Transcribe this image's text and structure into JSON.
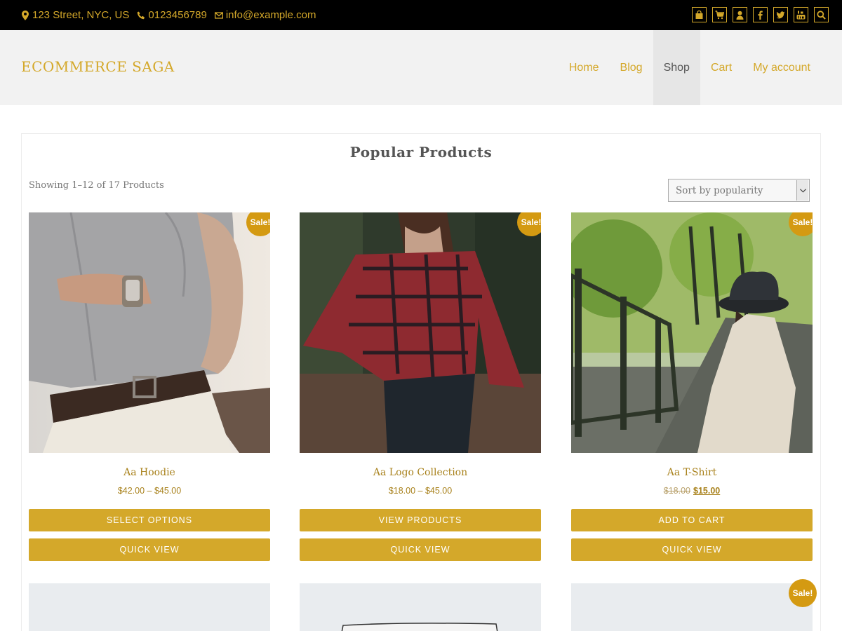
{
  "topbar": {
    "address": "123 Street, NYC, US",
    "phone": "0123456789",
    "email": "info@example.com",
    "social_icons": [
      "bag-icon",
      "cart-icon",
      "user-icon",
      "facebook-icon",
      "twitter-icon",
      "youtube-icon",
      "search-icon"
    ]
  },
  "header": {
    "logo": "ECOMMERCE SAGA",
    "nav": [
      {
        "label": "Home",
        "active": false
      },
      {
        "label": "Blog",
        "active": false
      },
      {
        "label": "Shop",
        "active": true
      },
      {
        "label": "Cart",
        "active": false
      },
      {
        "label": "My account",
        "active": false
      }
    ]
  },
  "shop": {
    "title": "Popular Products",
    "result_count": "Showing 1–12 of 17 Products",
    "sort_selected": "Sort by popularity",
    "sale_label": "Sale!",
    "quick_view_label": "QUICK VIEW",
    "products": [
      {
        "name": "Aa Hoodie",
        "price": "$42.00 – $45.00",
        "old_price": "",
        "sale": true,
        "button": "SELECT OPTIONS"
      },
      {
        "name": "Aa Logo Collection",
        "price": "$18.00 – $45.00",
        "old_price": "",
        "sale": true,
        "button": "VIEW PRODUCTS"
      },
      {
        "name": "Aa T-Shirt",
        "price": "$15.00",
        "old_price": "$18.00",
        "sale": true,
        "button": "ADD TO CART"
      }
    ]
  },
  "colors": {
    "accent": "#d4a82a",
    "sale_badge": "#d49a12",
    "topbar_bg": "#000000",
    "header_bg": "#f2f2f2"
  }
}
